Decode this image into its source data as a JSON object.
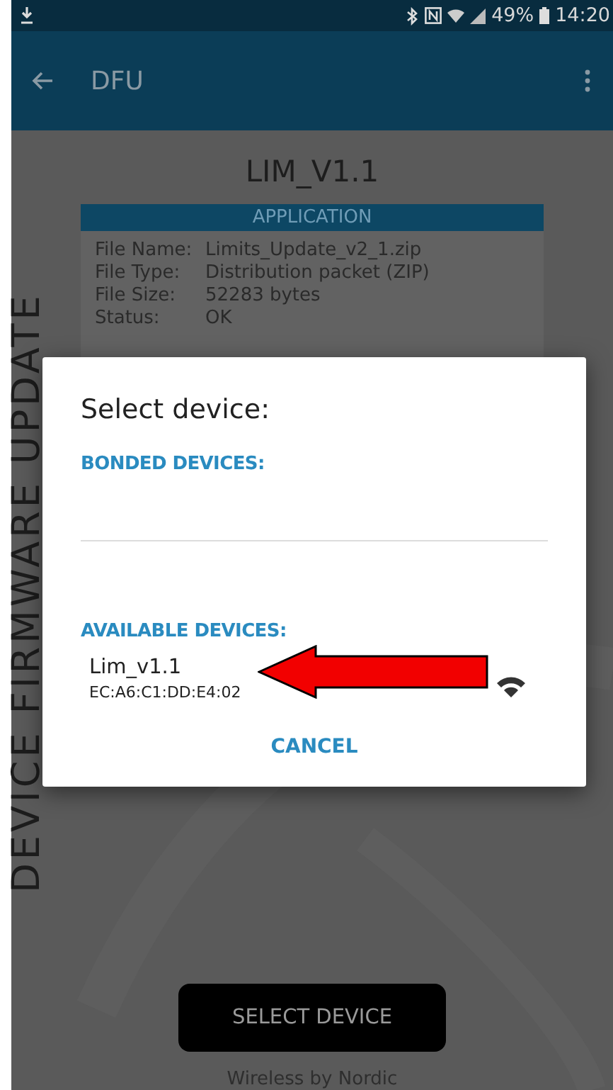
{
  "status_bar": {
    "battery": "49%",
    "time": "14:20"
  },
  "app_bar": {
    "title": "DFU"
  },
  "side_label": "DEVICE FIRMWARE UPDATE",
  "device_name": "LIM_V1.1",
  "application": {
    "header": "APPLICATION",
    "rows": [
      {
        "label": "File Name:",
        "value": "Limits_Update_v2_1.zip"
      },
      {
        "label": "File Type:",
        "value": "Distribution packet (ZIP)"
      },
      {
        "label": "File Size:",
        "value": "52283 bytes"
      },
      {
        "label": "Status:",
        "value": "OK"
      }
    ]
  },
  "select_button": "SELECT DEVICE",
  "footer": "Wireless by Nordic",
  "dialog": {
    "title": "Select device:",
    "sections": [
      {
        "heading": "BONDED DEVICES:"
      },
      {
        "heading": "AVAILABLE DEVICES:",
        "devices": [
          {
            "name": "Lim_v1.1",
            "address": "EC:A6:C1:DD:E4:02"
          }
        ]
      }
    ],
    "cancel": "CANCEL"
  }
}
